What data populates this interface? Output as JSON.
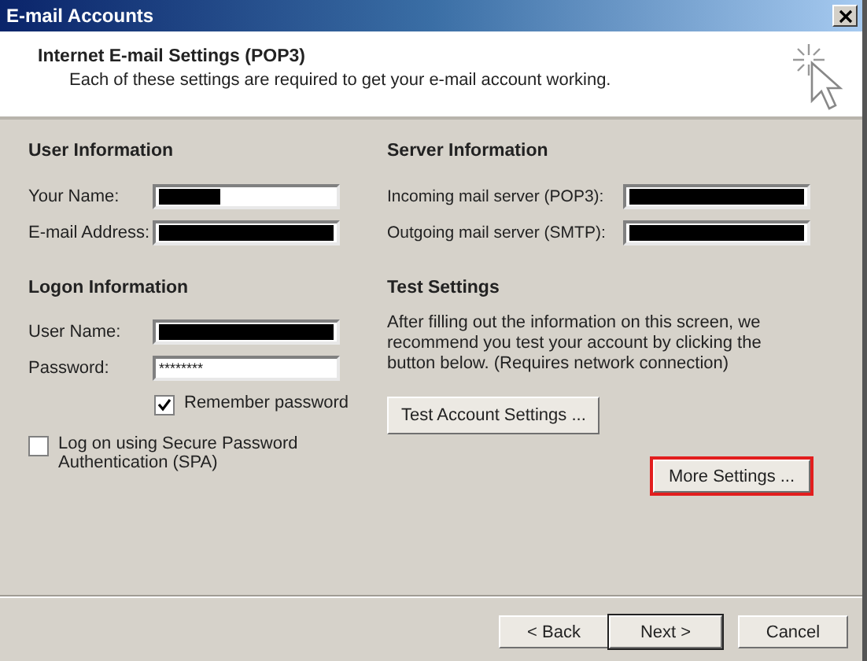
{
  "window": {
    "title": "E-mail Accounts"
  },
  "header": {
    "title": "Internet E-mail Settings (POP3)",
    "subtitle": "Each of these settings are required to get your e-mail account working."
  },
  "user_information": {
    "heading": "User Information",
    "fields": [
      {
        "label": "Your Name:",
        "fully_redacted": false
      },
      {
        "label": "E-mail Address:",
        "fully_redacted": true
      }
    ]
  },
  "logon_information": {
    "heading": "Logon Information",
    "fields": [
      {
        "label": "User Name:",
        "fully_redacted": true
      },
      {
        "label": "Password:",
        "value": "********"
      }
    ],
    "remember_password": {
      "label": "Remember password",
      "checked": true
    },
    "spa": {
      "label": "Log on using Secure Password Authentication (SPA)",
      "checked": false
    }
  },
  "server_information": {
    "heading": "Server Information",
    "fields": [
      {
        "label": "Incoming mail server (POP3):",
        "fully_redacted": true
      },
      {
        "label": "Outgoing mail server (SMTP):",
        "fully_redacted": true
      }
    ]
  },
  "test_settings": {
    "heading": "Test Settings",
    "text": "After filling out the information on this screen, we recommend you test your account by clicking the button below. (Requires network connection)",
    "button": "Test Account Settings ..."
  },
  "more_settings": {
    "label": "More Settings ...",
    "highlighted": true
  },
  "buttons": [
    {
      "label": "< Back",
      "default": false
    },
    {
      "label": "Next >",
      "default": true
    },
    {
      "label": "Cancel",
      "default": false
    }
  ]
}
